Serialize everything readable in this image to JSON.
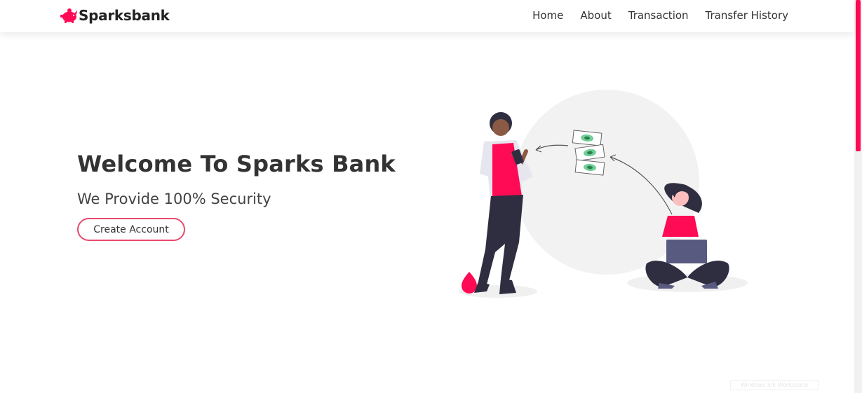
{
  "brand": {
    "name": "Sparksbank",
    "logo_icon": "piggy-bank-icon",
    "accent_color": "#ff0a54"
  },
  "nav": {
    "items": [
      {
        "label": "Home"
      },
      {
        "label": "About"
      },
      {
        "label": "Transaction"
      },
      {
        "label": "Transfer History"
      }
    ]
  },
  "hero": {
    "title": "Welcome To Sparks Bank",
    "subtitle": "We Provide 100% Security",
    "cta_label": "Create Account",
    "cta_border_color": "#e84a6f"
  },
  "overlay": {
    "watermark_text": "Windows Ink Workspace"
  }
}
